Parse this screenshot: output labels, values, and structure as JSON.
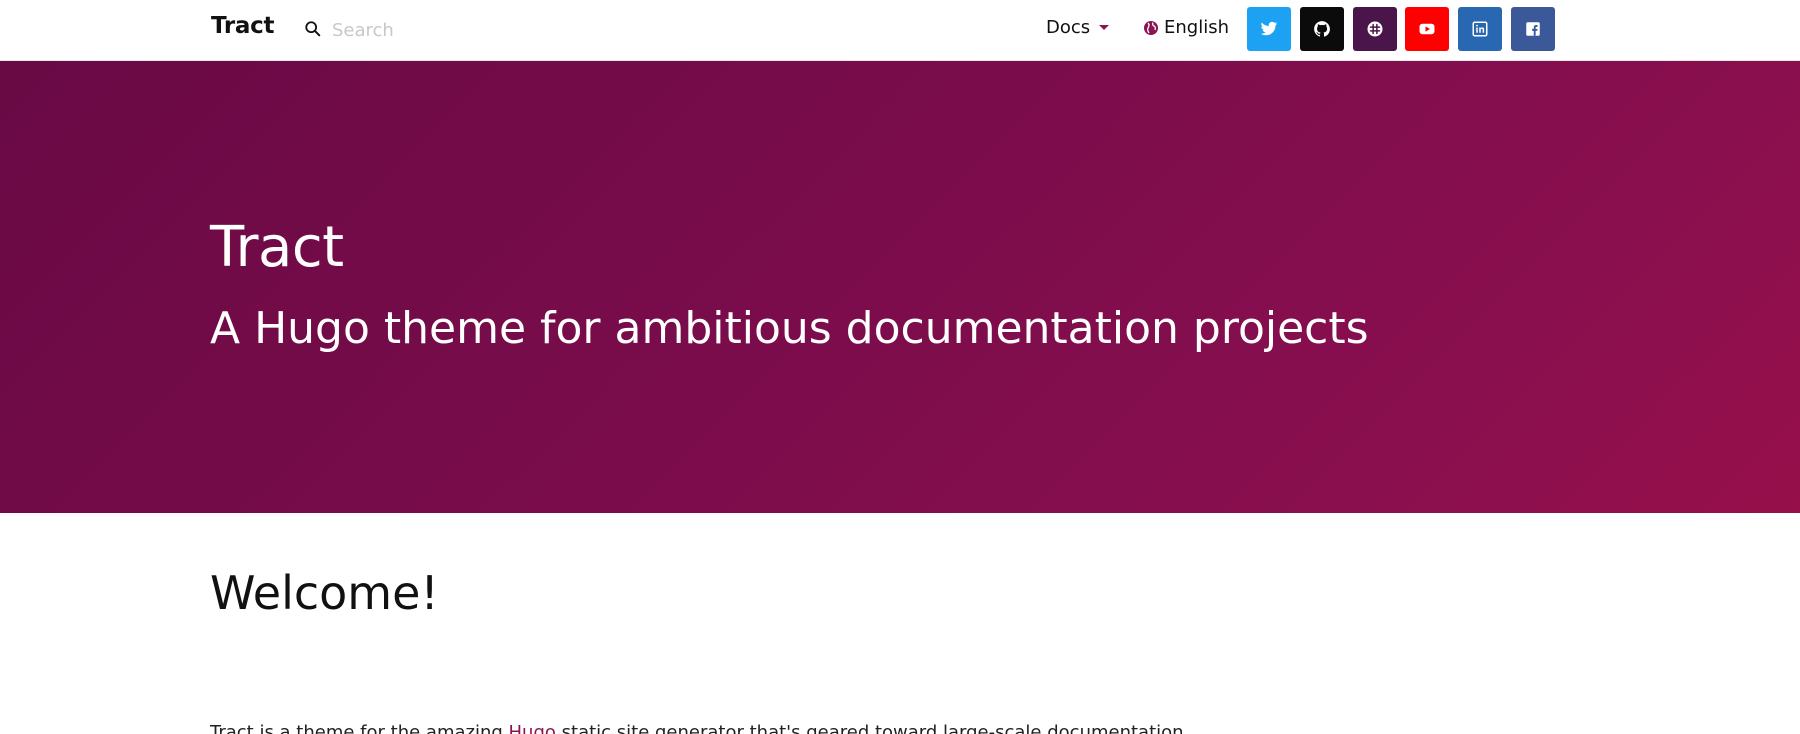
{
  "navbar": {
    "brand": "Tract",
    "search_placeholder": "Search",
    "docs_label": "Docs",
    "language_label": "English",
    "social": [
      {
        "name": "twitter-icon",
        "color": "#1da1f2"
      },
      {
        "name": "github-icon",
        "color": "#0b0b0b"
      },
      {
        "name": "slack-icon",
        "color": "#4a154b"
      },
      {
        "name": "youtube-icon",
        "color": "#ff0000"
      },
      {
        "name": "linkedin-icon",
        "color": "#2867b2"
      },
      {
        "name": "facebook-icon",
        "color": "#3b5998"
      }
    ]
  },
  "hero": {
    "title": "Tract",
    "subtitle": "A Hugo theme for ambitious documentation projects",
    "gradient_start": "#690a45",
    "gradient_end": "#960f4a"
  },
  "content": {
    "heading": "Welcome!",
    "intro_before": "Tract is a theme for the amazing ",
    "intro_link": "Hugo",
    "intro_after": " static site generator that's geared toward large-scale documentation"
  },
  "colors": {
    "accent": "#8b1552"
  }
}
